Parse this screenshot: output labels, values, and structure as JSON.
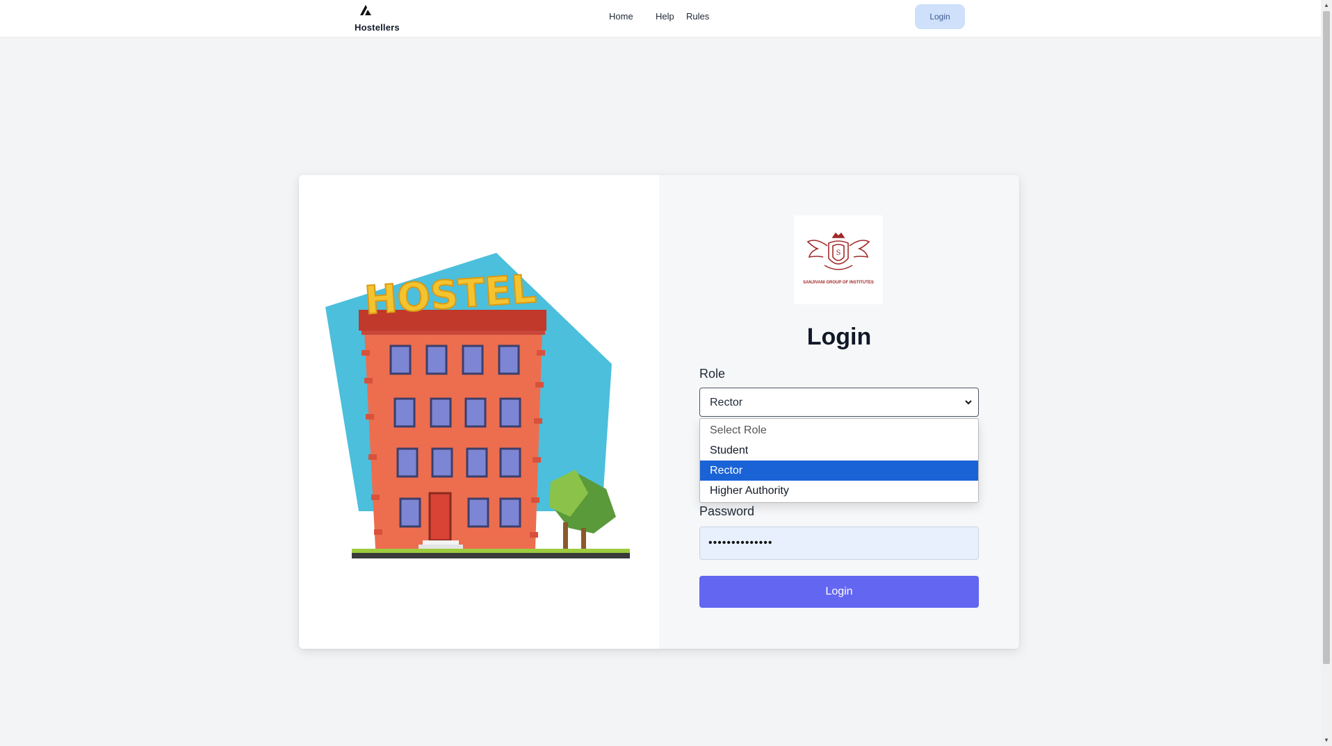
{
  "nav": {
    "brand": "Hostellers",
    "links": [
      "Home",
      "Help",
      "Rules"
    ],
    "login_label": "Login"
  },
  "login": {
    "logo_caption": "SANJIVANI GROUP OF INSTITUTES",
    "title": "Login",
    "role_label": "Role",
    "role_selected": "Rector",
    "role_options": [
      "Select Role",
      "Student",
      "Rector",
      "Higher Authority"
    ],
    "password_label": "Password",
    "password_value": "••••••••••••••",
    "submit_label": "Login"
  },
  "illustration": {
    "sign_text": "HOSTEL"
  },
  "colors": {
    "accent": "#6366f1",
    "selected_option": "#1a63d6",
    "nav_login_bg": "#cfe0fb"
  }
}
